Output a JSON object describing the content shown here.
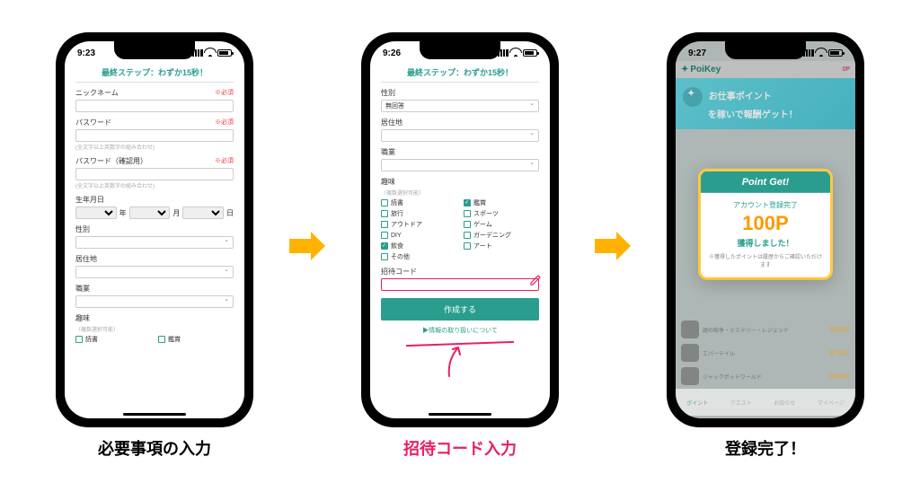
{
  "captions": {
    "c1": "必要事項の入力",
    "c2": "招待コード入力",
    "c3": "登録完了！"
  },
  "status": {
    "time1": "9:23",
    "time2": "9:26",
    "time3": "9:27"
  },
  "stepTitle": "最終ステップ：わずか15秒！",
  "required": "※必須",
  "p1": {
    "nickname": "ニックネーム",
    "password": "パスワード",
    "pwHint": "(全文字以上英数字の組み合わせ)",
    "passwordConfirm": "パスワード（確認用）",
    "dob": "生年月日",
    "y": "年",
    "m": "月",
    "d": "日",
    "gender": "性別",
    "residence": "居住地",
    "occupation": "職業",
    "hobby": "趣味",
    "hobbyHint": "（複数選択可能）",
    "reading": "読書",
    "kansho": "鑑賞"
  },
  "p2": {
    "gender": "性別",
    "genderVal": "無回答",
    "residence": "居住地",
    "occupation": "職業",
    "hobby": "趣味",
    "hobbyHint": "（複数選択可能）",
    "hobbies": {
      "reading": "読書",
      "kansho": "鑑賞",
      "travel": "旅行",
      "sports": "スポーツ",
      "outdoor": "アウトドア",
      "game": "ゲーム",
      "diy": "DIY",
      "gardening": "ガーデニング",
      "food": "飲食",
      "art": "アート",
      "other": "その他"
    },
    "invite": "招待コード",
    "create": "作成する",
    "policy": "▶情報の取り扱いについて"
  },
  "p3": {
    "brand": "PoiKey",
    "ptsTop": "0P",
    "banner1": "お仕事ポイント",
    "banner2": "を稼いで報酬ゲット！",
    "modalHead": "Point Get!",
    "modalT1": "アカウント登録完了",
    "modalPts": "100P",
    "modalT2": "獲得しました！",
    "modalT3": "※獲得したポイントは履歴からご確認いただけます",
    "items": [
      {
        "title": "謎の館争・ミステリー・レジェンド",
        "pt": "9000P"
      },
      {
        "title": "エバーテイル",
        "pt": "9750P"
      },
      {
        "title": "ジャックポットワールド",
        "pt": "6000P"
      }
    ],
    "nav": [
      "ポイント",
      "クエスト",
      "お知らせ",
      "マイページ"
    ]
  }
}
